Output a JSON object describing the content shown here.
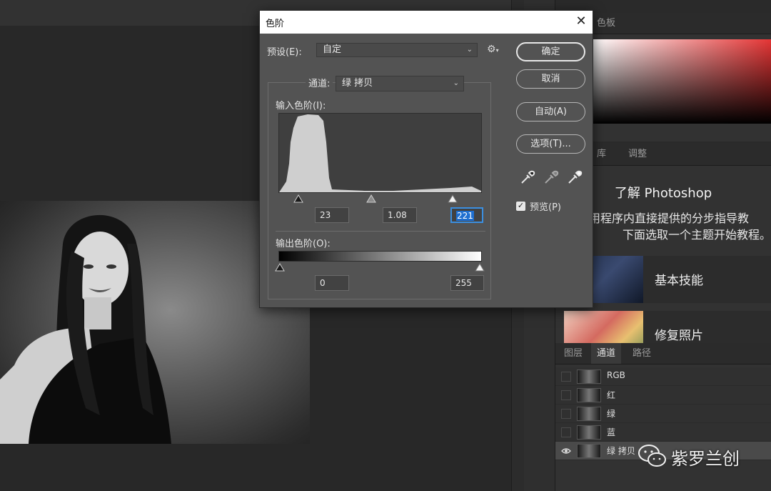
{
  "dialog": {
    "title": "色阶",
    "close_icon": "close-icon",
    "preset_label": "预设(E):",
    "preset_value": "自定",
    "channel_label": "通道:",
    "channel_value": "绿 拷贝",
    "input_levels_label": "输入色阶(I):",
    "input_black": "23",
    "input_gamma": "1.08",
    "input_white": "221",
    "output_levels_label": "输出色阶(O):",
    "output_black": "0",
    "output_white": "255",
    "buttons": {
      "ok": "确定",
      "cancel": "取消",
      "auto": "自动(A)",
      "options": "选项(T)..."
    },
    "preview_label": "预览(P)",
    "preview_checked": true
  },
  "color_panel": {
    "tab": "色板"
  },
  "learn_panel": {
    "tabs": [
      "库",
      "调整"
    ],
    "title": "了解 Photoshop",
    "desc_line1": "应用程序内直接提供的分步指导教",
    "desc_line2": "下面选取一个主题开始教程。",
    "cards": [
      "基本技能",
      "修复照片"
    ]
  },
  "channels_panel": {
    "tabs": [
      "图层",
      "通道",
      "路径"
    ],
    "active_tab": "通道",
    "rows": [
      "RGB",
      "红",
      "绿",
      "蓝",
      "绿 拷贝"
    ],
    "selected_row": "绿 拷贝"
  },
  "watermark": {
    "text": "紫罗兰创"
  },
  "colors": {
    "dialog_bg": "#535353",
    "accent_blue": "#1f6fd0"
  }
}
